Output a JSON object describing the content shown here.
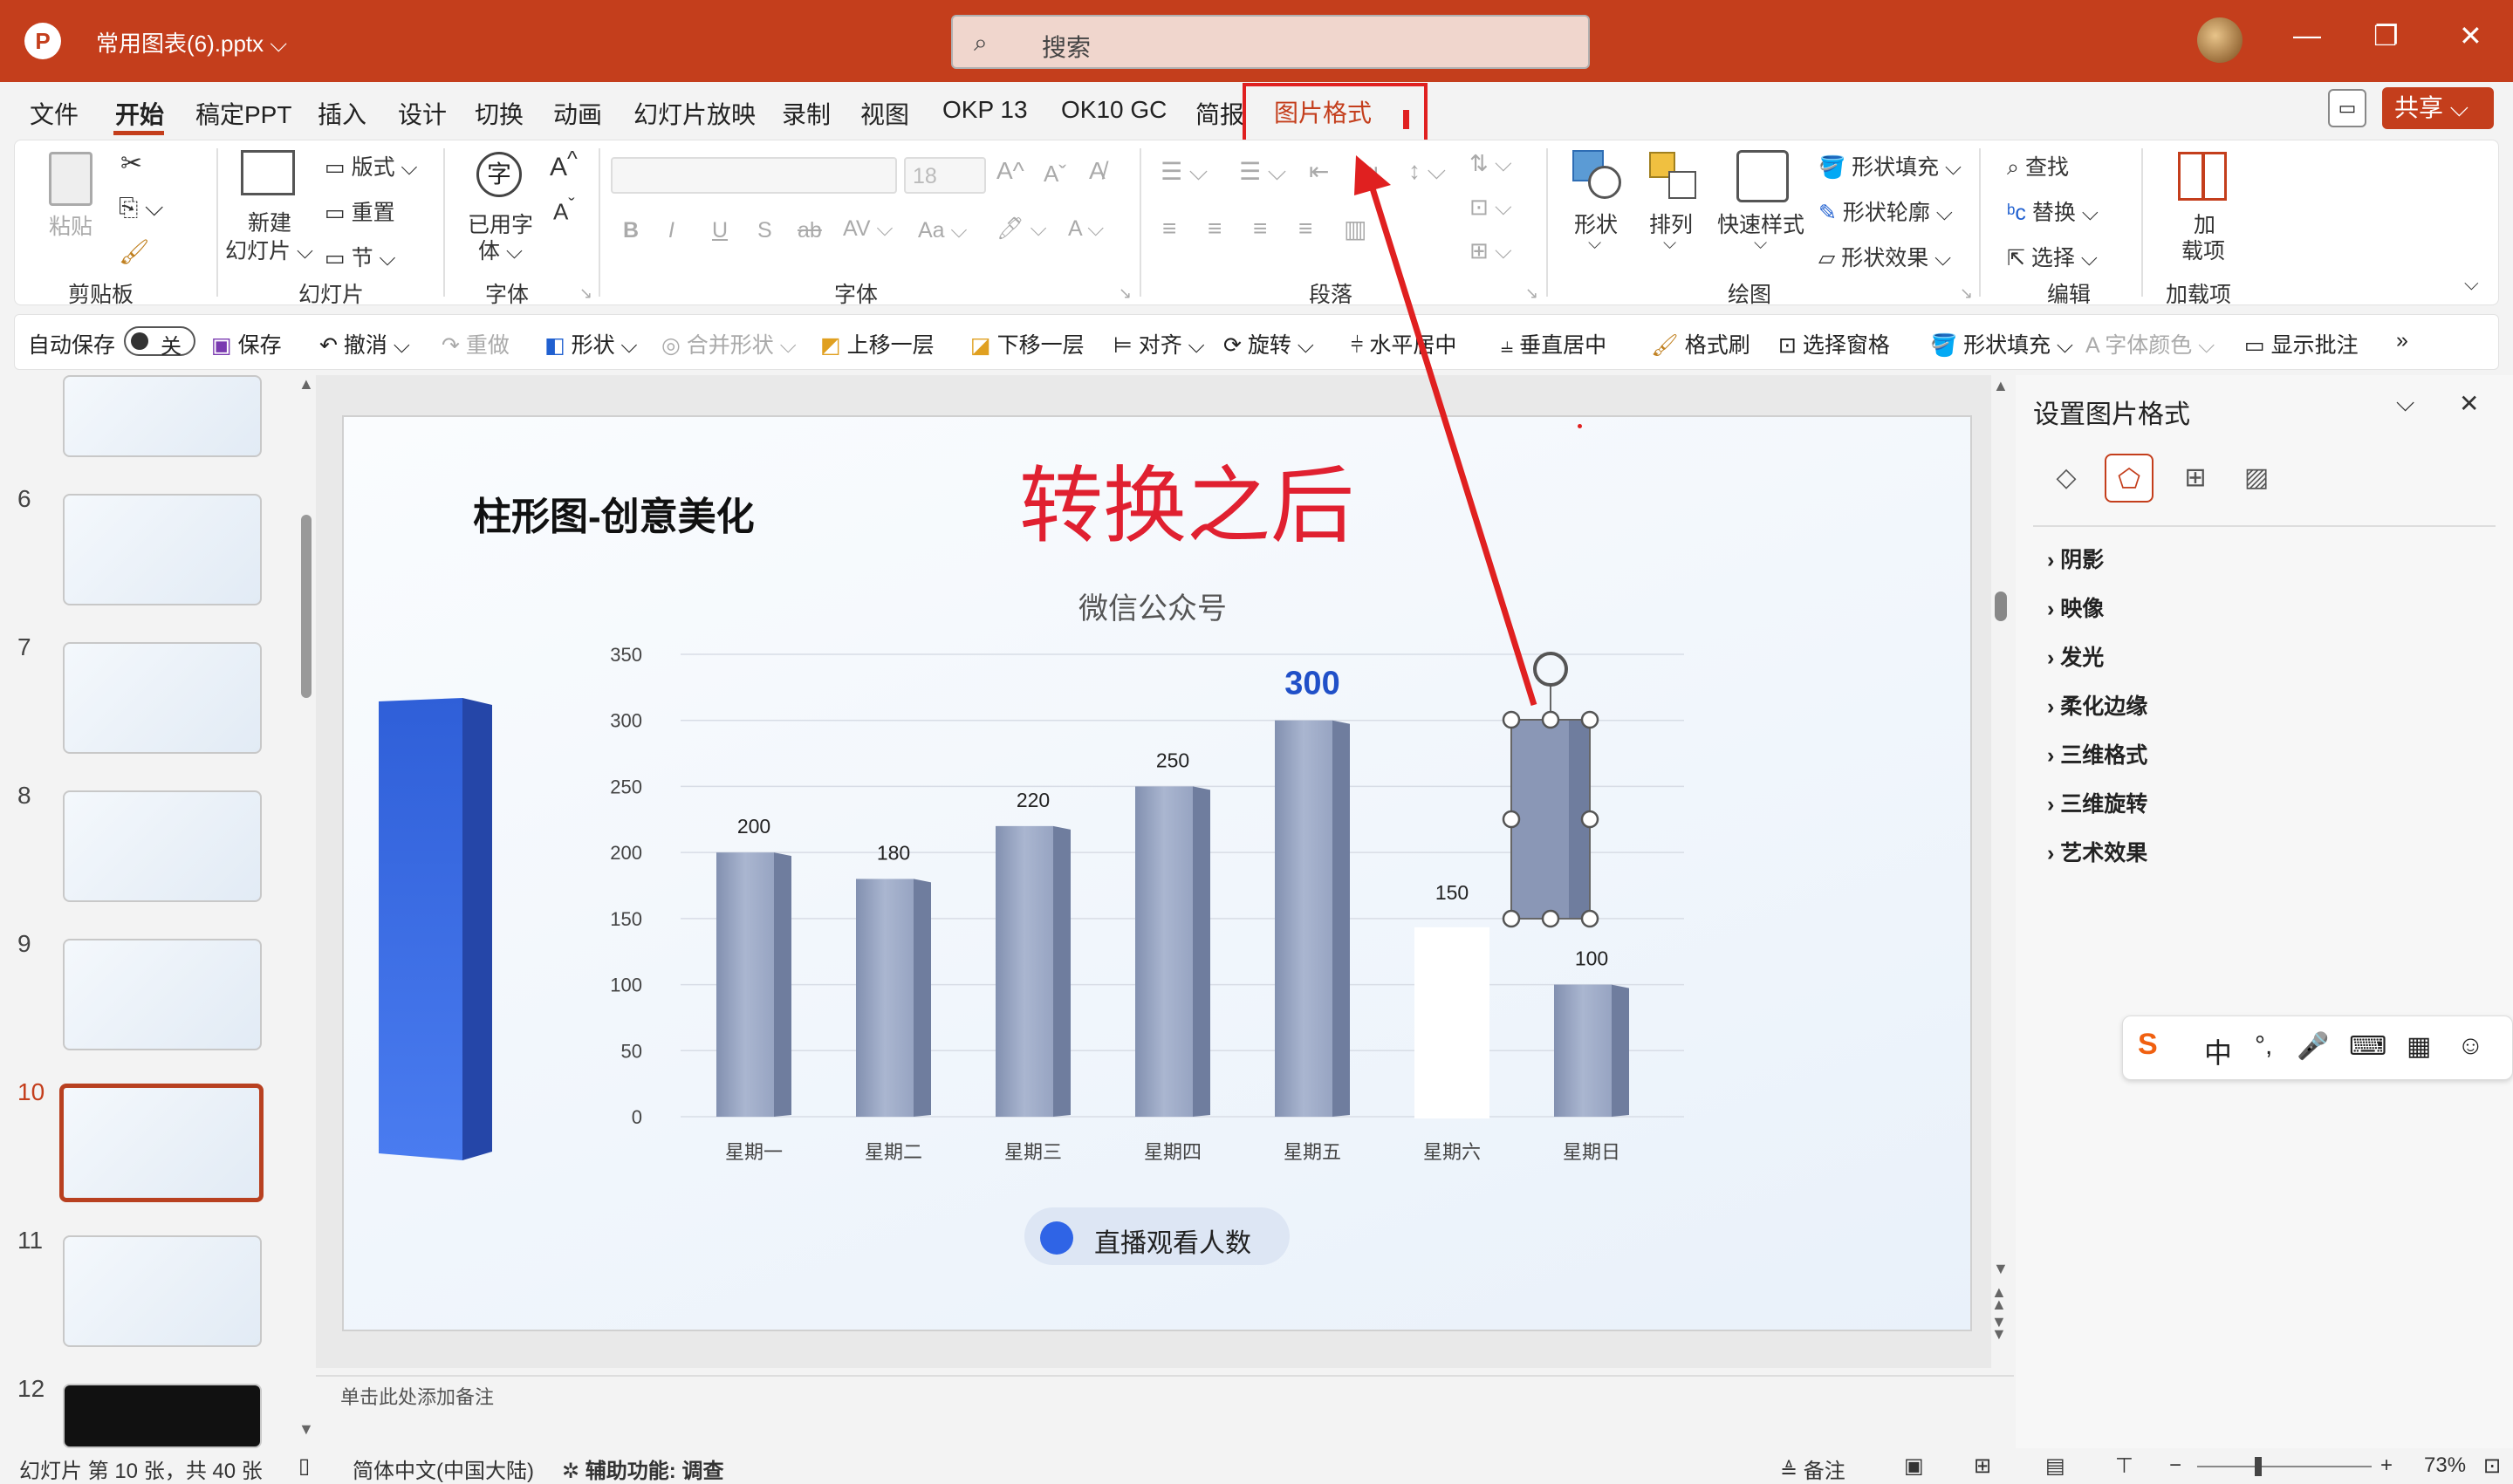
{
  "titlebar": {
    "app_glyph": "P",
    "file_title": "常用图表(6).pptx ⌵",
    "search_placeholder": "搜索",
    "min": "—",
    "restore": "❐",
    "close": "✕"
  },
  "menu": {
    "items": [
      "文件",
      "开始",
      "稿定PPT",
      "插入",
      "设计",
      "切换",
      "动画",
      "幻灯片放映",
      "录制",
      "视图",
      "OKP 13",
      "OK10 GC",
      "简报"
    ],
    "picture_format": "图片格式",
    "share": "共享 ⌵"
  },
  "ribbon": {
    "clipboard": {
      "paste": "粘贴",
      "group": "剪贴板"
    },
    "slides": {
      "new_slide_1": "新建",
      "new_slide_2": "幻灯片 ⌵",
      "layout": "版式 ⌵",
      "reset": "重置",
      "section": "节 ⌵",
      "group": "幻灯片"
    },
    "font_used": {
      "label_1": "已用字",
      "label_2": "体 ⌵",
      "group": "字体"
    },
    "font": {
      "size": "18",
      "group": "字体"
    },
    "paragraph": {
      "group": "段落"
    },
    "drawing": {
      "shape": "形状",
      "arrange": "排列",
      "quick_styles": "快速样式",
      "shape_fill": "形状填充 ⌵",
      "shape_outline": "形状轮廓 ⌵",
      "shape_effects": "形状效果 ⌵",
      "group": "绘图"
    },
    "editing": {
      "find": "查找",
      "replace": "替换",
      "select": "选择 ⌵",
      "group": "编辑"
    },
    "addins": {
      "label_1": "加",
      "label_2": "载项",
      "group": "加载项"
    }
  },
  "qat": {
    "autosave": "自动保存",
    "autosave_state": "关",
    "save": "保存",
    "undo": "撤消",
    "redo": "重做",
    "shape": "形状 ⌵",
    "merge_shapes": "合并形状 ⌵",
    "bring_forward": "上移一层",
    "send_backward": "下移一层",
    "align": "对齐 ⌵",
    "rotate": "旋转 ⌵",
    "h_center": "水平居中",
    "v_center": "垂直居中",
    "format_painter": "格式刷",
    "selection_pane": "选择窗格",
    "shape_fill": "形状填充 ⌵",
    "font_color": "字体颜色 ⌵",
    "show_comments": "显示批注",
    "more": "»"
  },
  "thumbnails": {
    "numbers": [
      "6",
      "7",
      "8",
      "9",
      "10",
      "11",
      "12"
    ],
    "active": "10"
  },
  "slide": {
    "title": "柱形图-创意美化",
    "banner": "转换之后",
    "notes_placeholder": "单击此处添加备注"
  },
  "chart_data": {
    "type": "bar",
    "title": "微信公众号",
    "categories": [
      "星期一",
      "星期二",
      "星期三",
      "星期四",
      "星期五",
      "星期六",
      "星期日"
    ],
    "series": [
      {
        "name": "直播观看人数",
        "values": [
          200,
          180,
          220,
          250,
          300,
          150,
          100
        ]
      }
    ],
    "data_labels": [
      "200",
      "180",
      "220",
      "250",
      "300",
      "150",
      "100"
    ],
    "highlight": "星期五",
    "y_ticks": [
      "0",
      "50",
      "100",
      "150",
      "200",
      "250",
      "300",
      "350"
    ],
    "ylim": [
      0,
      350
    ],
    "grid": true,
    "legend": "bottom",
    "colors": {
      "bar": "#8c9ab8",
      "highlight_label": "#2050c8",
      "legend_dot": "#2f64e6"
    }
  },
  "format_pane": {
    "title": "设置图片格式",
    "sections": [
      "阴影",
      "映像",
      "发光",
      "柔化边缘",
      "三维格式",
      "三维旋转",
      "艺术效果"
    ]
  },
  "ime": {
    "items": [
      "S",
      "中",
      "°,",
      "🎤",
      "⌨",
      "▦",
      "☺"
    ]
  },
  "status": {
    "slide_info": "幻灯片 第 10 张，共 40 张",
    "language": "简体中文(中国大陆)",
    "accessibility": "辅助功能: 调查",
    "notes": "备注",
    "zoom": "73%"
  },
  "colors": {
    "accent": "#c43e1c",
    "annotation": "#e02020"
  }
}
